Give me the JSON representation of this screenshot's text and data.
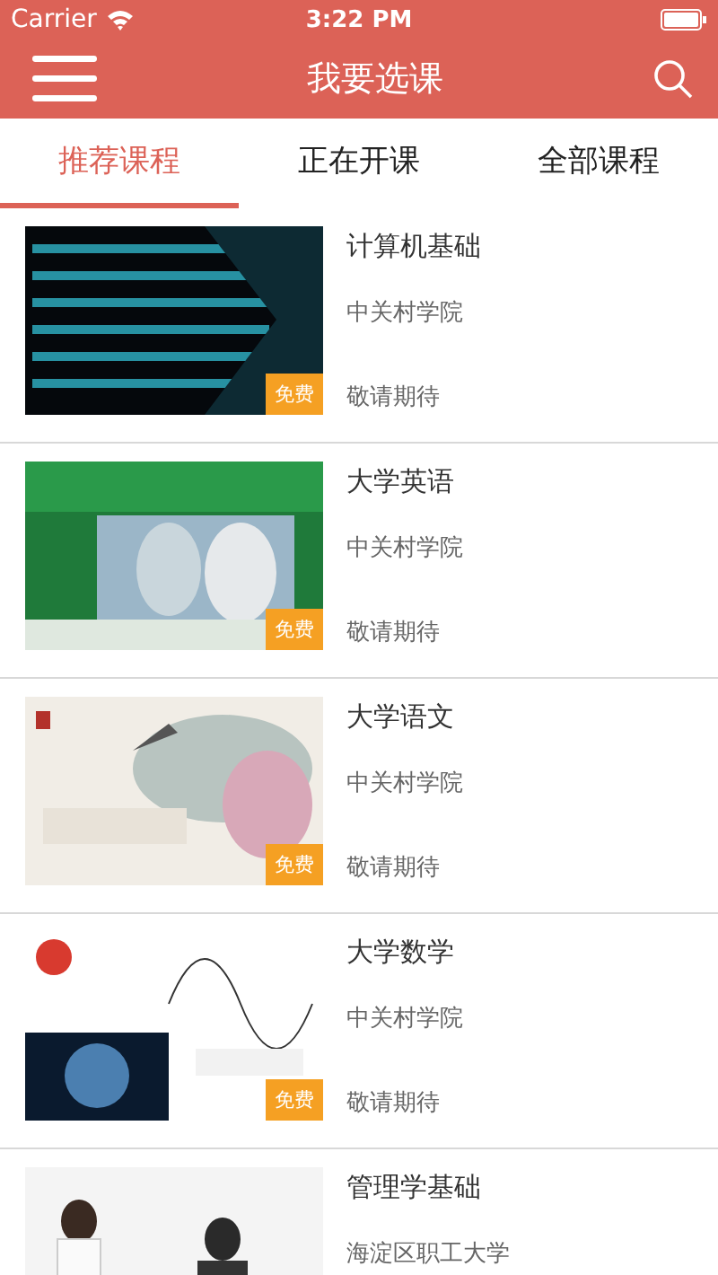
{
  "status_bar": {
    "carrier": "Carrier",
    "time": "3:22 PM"
  },
  "header": {
    "title": "我要选课"
  },
  "tabs": [
    {
      "label": "推荐课程",
      "selected": true
    },
    {
      "label": "正在开课",
      "selected": false
    },
    {
      "label": "全部课程",
      "selected": false
    }
  ],
  "courses": [
    {
      "badge": "免费",
      "title": "计算机基础",
      "school": "中关村学院",
      "status": "敬请期待"
    },
    {
      "badge": "免费",
      "title": "大学英语",
      "school": "中关村学院",
      "status": "敬请期待"
    },
    {
      "badge": "免费",
      "title": "大学语文",
      "school": "中关村学院",
      "status": "敬请期待"
    },
    {
      "badge": "免费",
      "title": "大学数学",
      "school": "中关村学院",
      "status": "敬请期待"
    },
    {
      "title": "管理学基础",
      "school": "海淀区职工大学"
    }
  ]
}
